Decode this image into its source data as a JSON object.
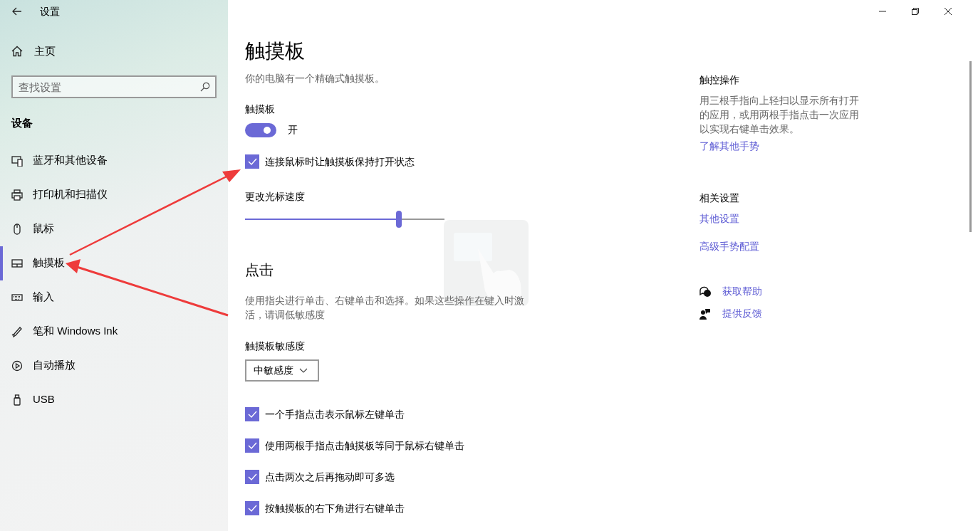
{
  "window": {
    "title": "设置"
  },
  "sidebar": {
    "home": "主页",
    "search": {
      "placeholder": "查找设置"
    },
    "section": "设备",
    "items": [
      {
        "label": "蓝牙和其他设备",
        "kind": "bluetooth",
        "selected": false
      },
      {
        "label": "打印机和扫描仪",
        "kind": "printer",
        "selected": false
      },
      {
        "label": "鼠标",
        "kind": "mouse",
        "selected": false
      },
      {
        "label": "触摸板",
        "kind": "touchpad",
        "selected": true
      },
      {
        "label": "输入",
        "kind": "keyboard",
        "selected": false
      },
      {
        "label": "笔和 Windows Ink",
        "kind": "pen",
        "selected": false
      },
      {
        "label": "自动播放",
        "kind": "autoplay",
        "selected": false
      },
      {
        "label": "USB",
        "kind": "usb",
        "selected": false
      }
    ]
  },
  "main": {
    "title": "触摸板",
    "description": "你的电脑有一个精确式触摸板。",
    "toggle": {
      "label": "触摸板",
      "on": true,
      "state_text": "开"
    },
    "keep_on": {
      "label": "连接鼠标时让触摸板保持打开状态",
      "checked": true
    },
    "cursor_speed": {
      "label": "更改光标速度",
      "level": 0.77
    },
    "taps": {
      "heading": "点击",
      "description": "使用指尖进行单击、右键单击和选择。如果这些操作在键入时激活，请调低敏感度",
      "sensitivity": {
        "label": "触摸板敏感度",
        "value": "中敏感度"
      },
      "options": [
        {
          "label": "一个手指点击表示鼠标左键单击",
          "checked": true
        },
        {
          "label": "使用两根手指点击触摸板等同于鼠标右键单击",
          "checked": true
        },
        {
          "label": "点击两次之后再拖动即可多选",
          "checked": true
        },
        {
          "label": "按触摸板的右下角进行右键单击",
          "checked": true
        }
      ]
    }
  },
  "aside": {
    "gestures": {
      "heading": "触控操作",
      "text": "用三根手指向上轻扫以显示所有打开的应用，或用两根手指点击一次应用以实现右键单击效果。",
      "link": "了解其他手势"
    },
    "related": {
      "heading": "相关设置",
      "links": [
        "其他设置",
        "高级手势配置"
      ]
    },
    "help": [
      {
        "label": "获取帮助",
        "kind": "help"
      },
      {
        "label": "提供反馈",
        "kind": "feedback"
      }
    ]
  }
}
